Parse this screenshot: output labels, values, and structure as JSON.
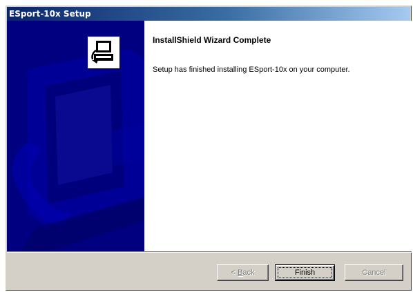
{
  "window": {
    "title": "ESport-10x Setup"
  },
  "wizard": {
    "heading": "InstallShield Wizard Complete",
    "message": "Setup has finished installing ESport-10x on your computer.",
    "side_icon": "computer-setup-icon"
  },
  "buttons": {
    "back_prefix": "< ",
    "back_accel": "B",
    "back_rest": "ack",
    "finish": "Finish",
    "cancel": "Cancel"
  },
  "colors": {
    "side_panel": "#000080",
    "titlebar_start": "#0a246a",
    "titlebar_end": "#a6caf0",
    "dialog_face": "#d4d0c8"
  }
}
